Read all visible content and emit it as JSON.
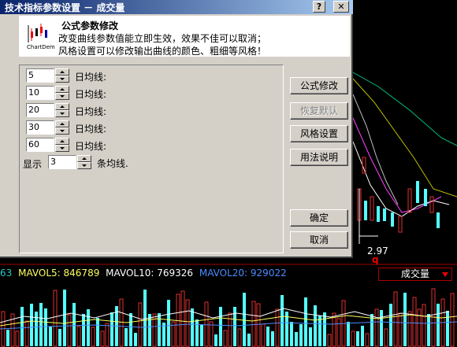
{
  "dialog": {
    "title": "技术指标参数设置 － 成交量",
    "help_glyph": "?",
    "close_glyph": "✕"
  },
  "header": {
    "logo_label": "ChartDem",
    "title": "公式参数修改",
    "line1": "改变曲线参数值能立即生效，效果不佳可以取消；",
    "line2": "风格设置可以修改输出曲线的颜色、粗细等风格！"
  },
  "params": [
    {
      "value": "5",
      "label": "日均线:"
    },
    {
      "value": "10",
      "label": "日均线:"
    },
    {
      "value": "20",
      "label": "日均线:"
    },
    {
      "value": "30",
      "label": "日均线:"
    },
    {
      "value": "60",
      "label": "日均线:"
    }
  ],
  "display": {
    "prefix": "显示",
    "value": "3",
    "suffix": "条均线."
  },
  "buttons": {
    "edit_formula": "公式修改",
    "restore_default": "恢复默认",
    "style_settings": "风格设置",
    "usage_help": "用法说明",
    "ok": "确定",
    "cancel": "取消"
  },
  "chart": {
    "price_label": "2.97",
    "marker": "q"
  },
  "status": {
    "prefix": "63",
    "mavol5": "MAVOL5: 846789",
    "mavol10": "MAVOL10: 769326",
    "mavol20": "MAVOL20: 929022",
    "indicator": "成交量"
  },
  "colors": {
    "mavol5": "#ffff60",
    "mavol10": "#ffffff",
    "mavol20": "#4a8cff",
    "prefix": "#2cc7c7",
    "up_bar": "#e03030",
    "down_bar": "#54ffff"
  }
}
